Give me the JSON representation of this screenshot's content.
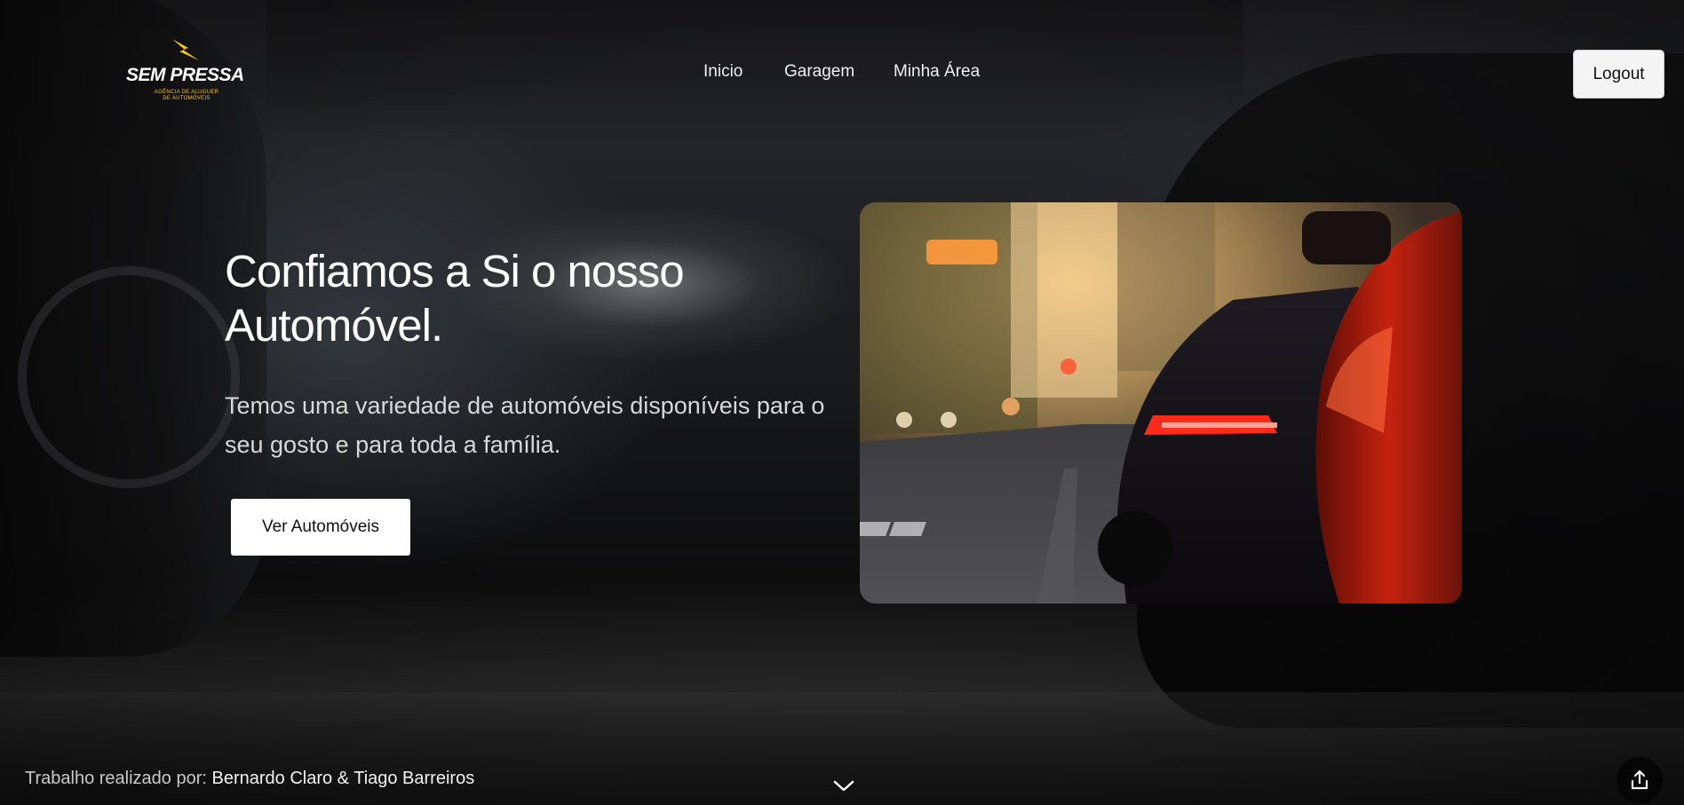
{
  "header": {
    "logo": {
      "name": "SEM PRESSA",
      "tagline": "AGÊNCIA DE ALUGUER DE AUTOMÓVEIS"
    },
    "nav": [
      {
        "label": "Inicio"
      },
      {
        "label": "Garagem"
      },
      {
        "label": "Minha Área"
      }
    ],
    "logout_label": "Logout"
  },
  "hero": {
    "title": "Confiamos a Si o nosso Automóvel.",
    "subtitle": "Temos uma variedade de automóveis disponíveis para o seu gosto e para toda a família.",
    "cta_label": "Ver Automóveis",
    "image_icon": "car-photo"
  },
  "footer": {
    "credits_prefix": "Trabalho realizado por:",
    "credits_names": "Bernardo Claro & Tiago Barreiros",
    "scroll_icon": "chevron-down-icon",
    "share_icon": "share-icon"
  },
  "colors": {
    "logo_accent": "#f5c518",
    "button_bg": "#ffffff",
    "text_primary": "#ffffff"
  }
}
